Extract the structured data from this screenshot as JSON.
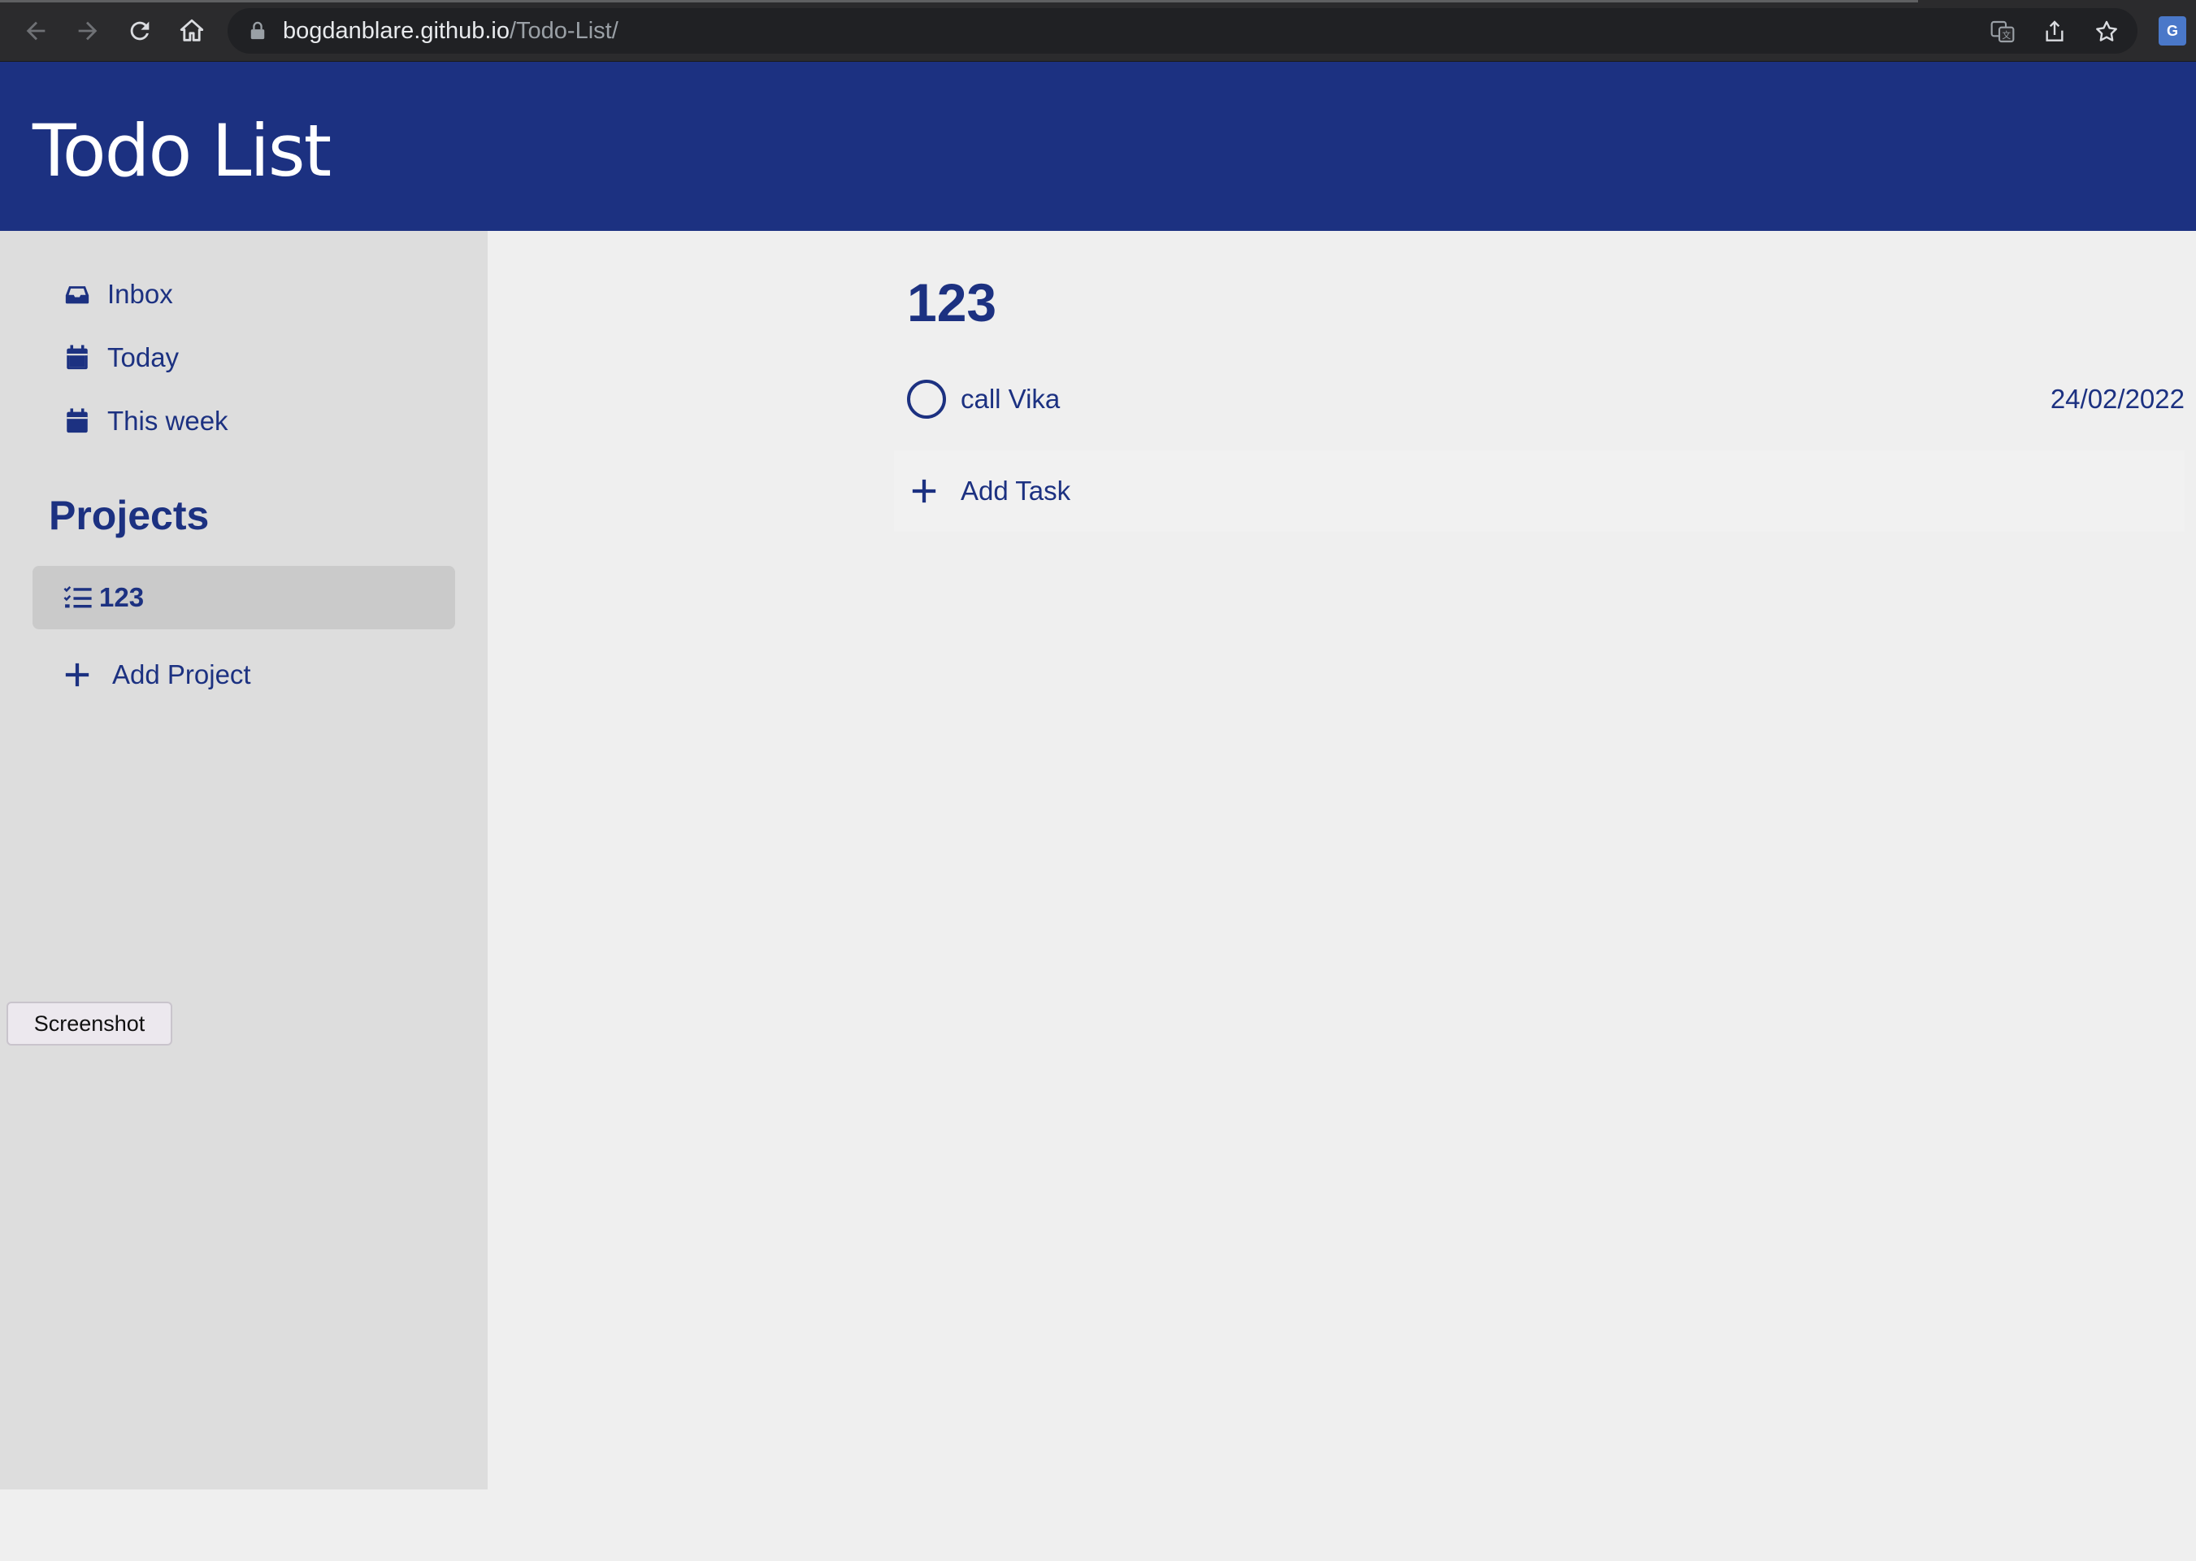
{
  "browser": {
    "url_host": "bogdanblare.github.io",
    "url_path": "/Todo-List/",
    "extension_label": "G"
  },
  "app": {
    "title": "Todo List",
    "accent_color": "#1c3181"
  },
  "sidebar": {
    "items": [
      {
        "label": "Inbox",
        "icon": "inbox-icon"
      },
      {
        "label": "Today",
        "icon": "calendar-icon"
      },
      {
        "label": "This week",
        "icon": "calendar-icon"
      }
    ],
    "projects_heading": "Projects",
    "projects": [
      {
        "label": "123",
        "icon": "checklist-icon",
        "active": true
      }
    ],
    "add_project_label": "Add Project"
  },
  "overlay": {
    "screenshot_label": "Screenshot"
  },
  "main": {
    "project_title": "123",
    "tasks": [
      {
        "text": "call Vika",
        "date": "24/02/2022",
        "done": false
      }
    ],
    "add_task_label": "Add Task"
  }
}
